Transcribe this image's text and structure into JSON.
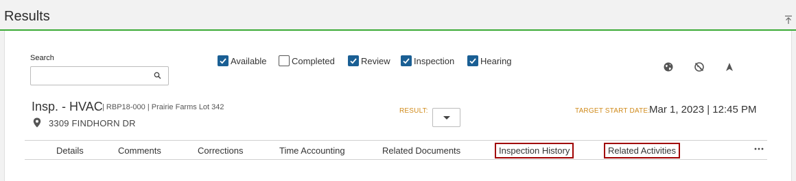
{
  "header": {
    "title": "Results",
    "collapse_icon": "collapse-up-icon"
  },
  "search": {
    "label": "Search",
    "value": "",
    "placeholder": "",
    "icon": "search-icon"
  },
  "filters": [
    {
      "label": "Available",
      "checked": true
    },
    {
      "label": "Completed",
      "checked": false
    },
    {
      "label": "Review",
      "checked": true
    },
    {
      "label": "Inspection",
      "checked": true
    },
    {
      "label": "Hearing",
      "checked": true
    }
  ],
  "toolbar": {
    "icons": [
      "globe-icon",
      "globe-off-icon",
      "navigation-arrow-icon"
    ]
  },
  "record": {
    "title": "Insp. - HVAC",
    "meta": "| RBP18-000 | Prairie Farms Lot 342",
    "address": "3309 FINDHORN DR",
    "result_label": "RESULT:",
    "result_value": "",
    "target_label": "TARGET START DATE:",
    "target_value": "Mar 1, 2023 | 12:45 PM"
  },
  "tabs": [
    {
      "label": "Details",
      "highlighted": false
    },
    {
      "label": "Comments",
      "highlighted": false
    },
    {
      "label": "Corrections",
      "highlighted": false
    },
    {
      "label": "Time Accounting",
      "highlighted": false
    },
    {
      "label": "Related Documents",
      "highlighted": false
    },
    {
      "label": "Inspection History",
      "highlighted": true
    },
    {
      "label": "Related Activities",
      "highlighted": true
    }
  ],
  "more_icon": "more-horizontal-icon",
  "colors": {
    "accent_line": "#3aaa35",
    "checkbox": "#1a5f94",
    "label_orange": "#d08a1a",
    "highlight_border": "#a00000"
  }
}
